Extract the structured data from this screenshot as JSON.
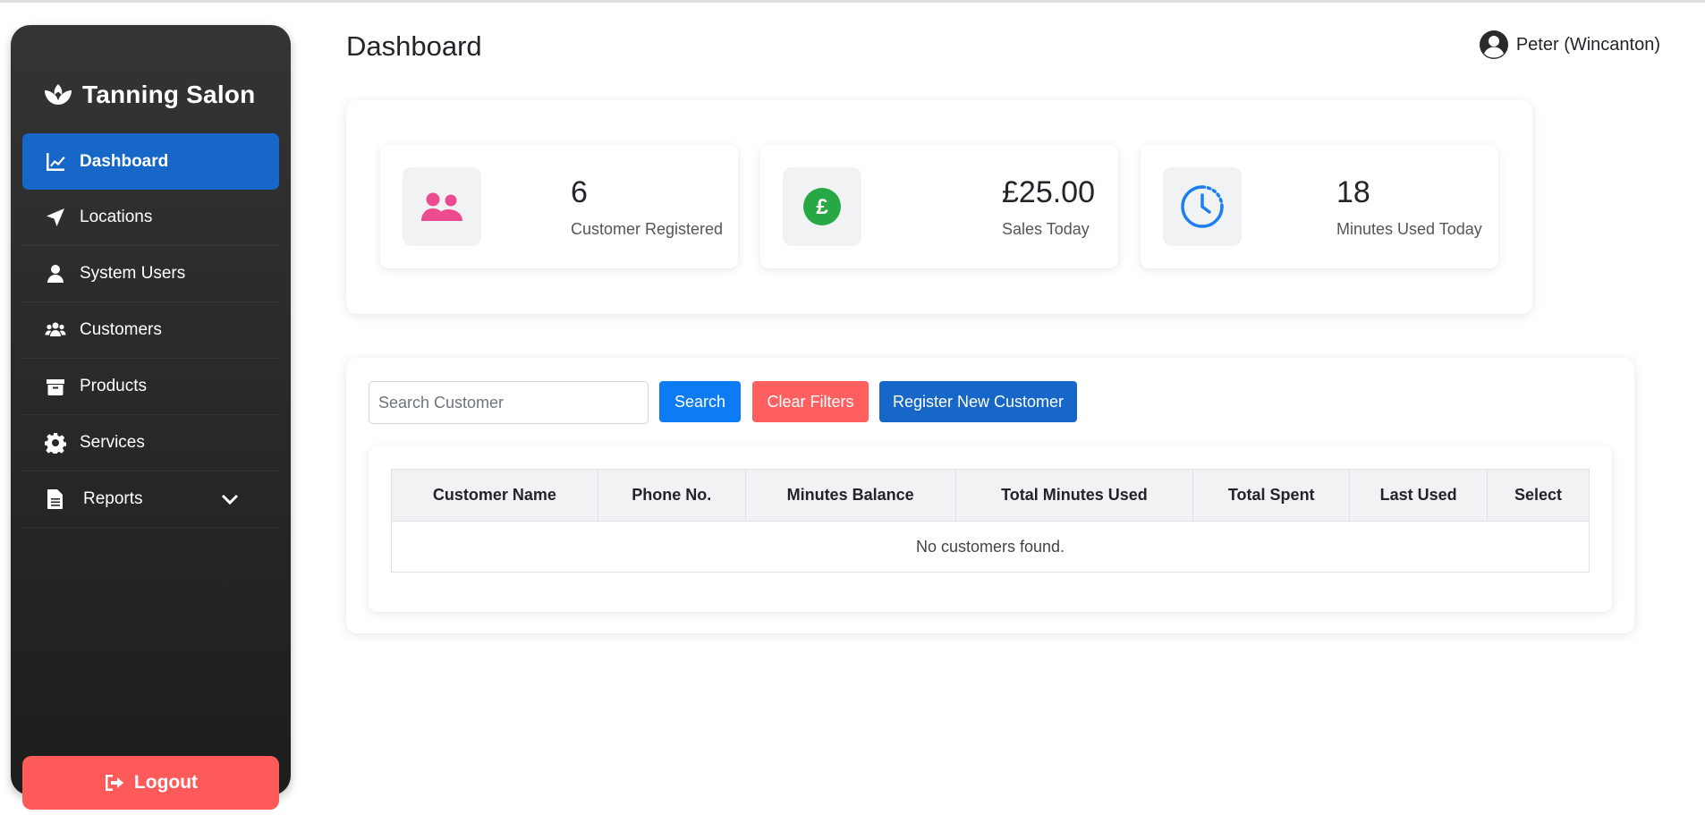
{
  "app": {
    "name": "Tanning Salon"
  },
  "sidebar": {
    "items": [
      {
        "label": "Dashboard",
        "icon": "chart-line-icon",
        "active": true
      },
      {
        "label": "Locations",
        "icon": "location-arrow-icon"
      },
      {
        "label": "System Users",
        "icon": "user-icon"
      },
      {
        "label": "Customers",
        "icon": "users-icon"
      },
      {
        "label": "Products",
        "icon": "box-icon"
      },
      {
        "label": "Services",
        "icon": "gear-icon"
      },
      {
        "label": "Reports",
        "icon": "file-icon",
        "has_submenu": true
      }
    ],
    "logout_label": "Logout"
  },
  "header": {
    "title": "Dashboard",
    "user_name": "Peter (Wincanton)"
  },
  "stats": [
    {
      "value": "6",
      "label": "Customer Registered",
      "icon": "users-icon",
      "color": "#ec4c8f"
    },
    {
      "value": "£25.00",
      "label": "Sales Today",
      "icon": "pound-icon",
      "color": "#28a745"
    },
    {
      "value": "18",
      "label": "Minutes Used Today",
      "icon": "clock-icon",
      "color": "#1e7ff0"
    }
  ],
  "customers": {
    "search_placeholder": "Search Customer",
    "search_button": "Search",
    "clear_button": "Clear Filters",
    "register_button": "Register New Customer",
    "columns": [
      "Customer Name",
      "Phone No.",
      "Minutes Balance",
      "Total Minutes Used",
      "Total Spent",
      "Last Used",
      "Select"
    ],
    "empty_message": "No customers found."
  },
  "colors": {
    "primary": "#1767c8",
    "danger": "#ff5a5a",
    "search": "#0d7bf4"
  }
}
